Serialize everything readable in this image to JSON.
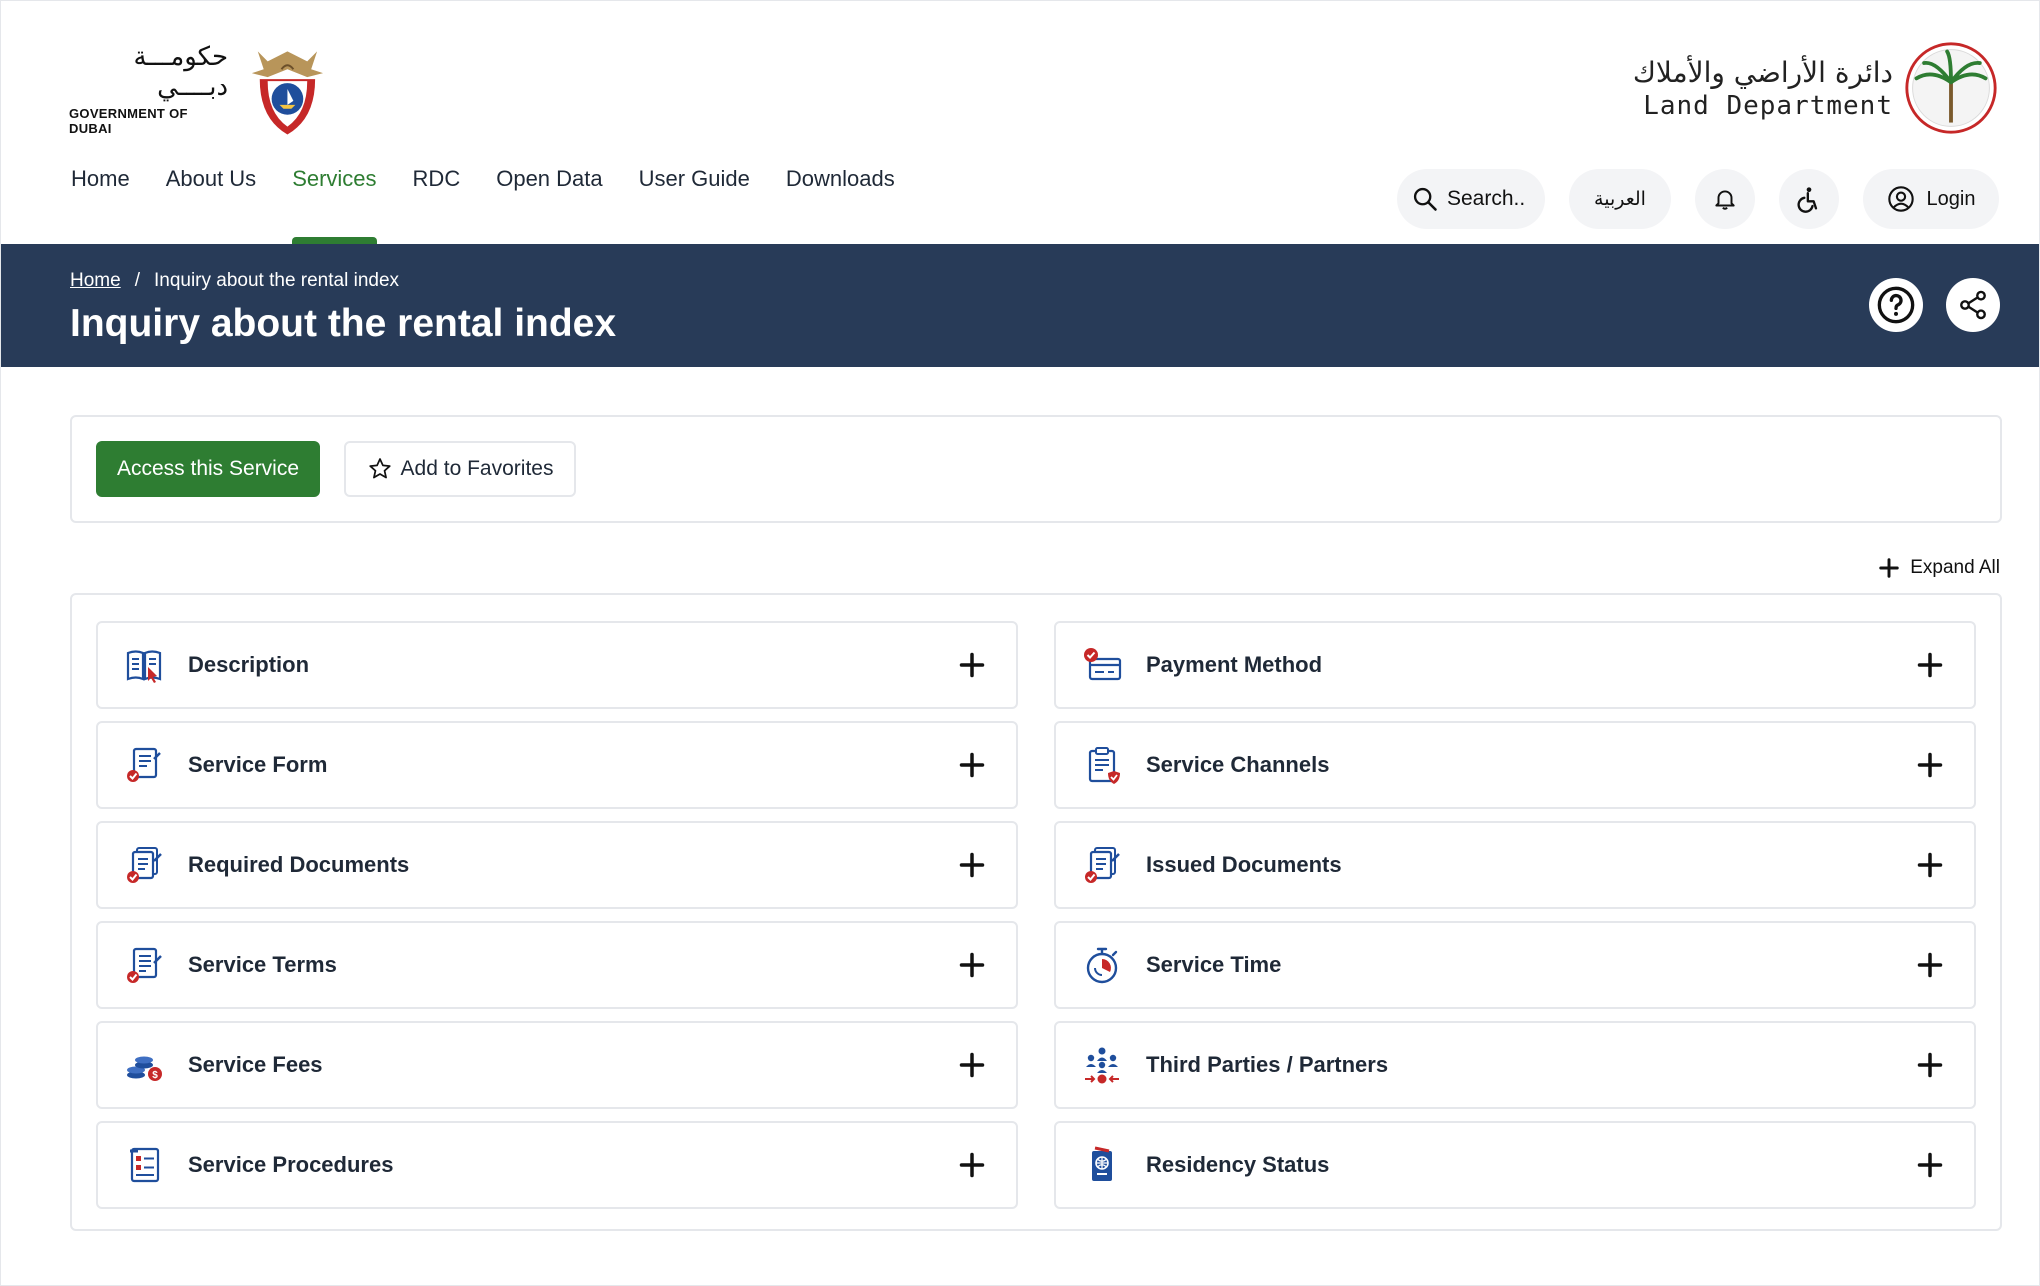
{
  "header": {
    "gov_logo": {
      "arabic": "حكومـــة دبــــي",
      "english": "GOVERNMENT OF DUBAI"
    },
    "dld_logo": {
      "arabic": "دائرة الأراضي والأملاك",
      "english": "Land Department"
    }
  },
  "nav": {
    "items": [
      {
        "label": "Home"
      },
      {
        "label": "About Us"
      },
      {
        "label": "Services",
        "active": true
      },
      {
        "label": "RDC"
      },
      {
        "label": "Open Data"
      },
      {
        "label": "User Guide"
      },
      {
        "label": "Downloads"
      }
    ]
  },
  "tools": {
    "search_label": "Search..",
    "language_label": "العربية",
    "login_label": "Login",
    "icons": [
      "search-icon",
      "bell-icon",
      "accessibility-icon",
      "user-icon"
    ]
  },
  "banner": {
    "breadcrumb_home": "Home",
    "breadcrumb_sep": "/",
    "breadcrumb_current": "Inquiry about the rental index",
    "title": "Inquiry about the rental index"
  },
  "actions": {
    "access_label": "Access this Service",
    "favorites_label": "Add to Favorites"
  },
  "expand_all_label": "Expand All",
  "accordion": {
    "left": [
      {
        "label": "Description",
        "icon": "book-icon"
      },
      {
        "label": "Service Form",
        "icon": "form-icon"
      },
      {
        "label": "Required Documents",
        "icon": "documents-icon"
      },
      {
        "label": "Service Terms",
        "icon": "terms-icon"
      },
      {
        "label": "Service Fees",
        "icon": "coins-icon"
      },
      {
        "label": "Service Procedures",
        "icon": "procedures-icon"
      }
    ],
    "right": [
      {
        "label": "Payment Method",
        "icon": "payment-icon"
      },
      {
        "label": "Service Channels",
        "icon": "clipboard-icon"
      },
      {
        "label": "Issued Documents",
        "icon": "documents-icon"
      },
      {
        "label": "Service Time",
        "icon": "stopwatch-icon"
      },
      {
        "label": "Third Parties / Partners",
        "icon": "partners-icon"
      },
      {
        "label": "Residency Status",
        "icon": "passport-icon"
      }
    ]
  },
  "colors": {
    "primary_green": "#2e7d32",
    "banner_navy": "#283b58",
    "icon_blue": "#1f4e9c",
    "icon_red": "#c62828"
  }
}
